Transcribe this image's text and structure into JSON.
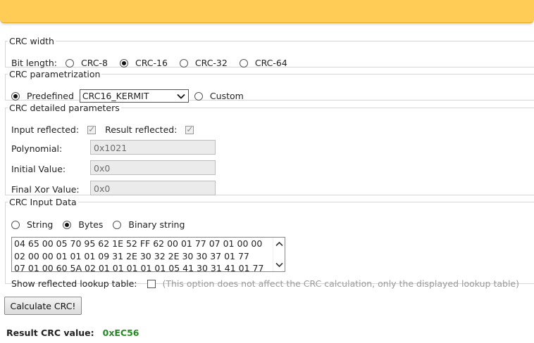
{
  "crc_width": {
    "legend": "CRC width",
    "bit_length_label": "Bit length:",
    "options": [
      "CRC-8",
      "CRC-16",
      "CRC-32",
      "CRC-64"
    ],
    "selected": "CRC-16"
  },
  "crc_param": {
    "legend": "CRC parametrization",
    "predefined_label": "Predefined",
    "predefined_value": "CRC16_KERMIT",
    "custom_label": "Custom"
  },
  "crc_detail": {
    "legend": "CRC detailed parameters",
    "input_reflected_label": "Input reflected:",
    "result_reflected_label": "Result reflected:",
    "polynomial_label": "Polynomial:",
    "polynomial_value": "0x1021",
    "initial_label": "Initial Value:",
    "initial_value": "0x0",
    "final_xor_label": "Final Xor Value:",
    "final_xor_value": "0x0"
  },
  "crc_input": {
    "legend": "CRC Input Data",
    "string_label": "String",
    "bytes_label": "Bytes",
    "binary_label": "Binary string",
    "lines": [
      "04 65 00 05 70 95 62 1E 52 FF 62 00 01 77 07 01 00 00",
      "02 00 00 01 01 01 09 31 2E 30 32 2E 30 30 37 01 77",
      "07 01 00 60 5A 02 01 01 01 01 01 05 41 30 31 41 01 77"
    ],
    "reflected_table_label": "Show reflected lookup table:",
    "reflected_table_note": "(This option does not affect the CRC calculation, only the displayed lookup table)"
  },
  "actions": {
    "calculate_label": "Calculate CRC!"
  },
  "result": {
    "label": "Result CRC value:",
    "value": "0xEC56"
  },
  "colors": {
    "banner": "#ffcc55",
    "result_value": "#228b22"
  }
}
